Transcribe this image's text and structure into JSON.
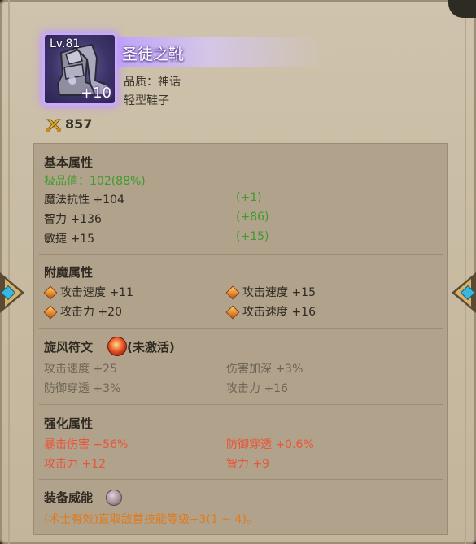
{
  "item": {
    "level": "Lv.81",
    "enhance": "+10",
    "name": "圣徒之靴",
    "quality": "品质：神话",
    "type": "轻型鞋子",
    "power": "857",
    "icon": "boots-icon",
    "frame_color": "#c9a8ff"
  },
  "basic": {
    "title": "基本属性",
    "grade": "极品值：102(88%)",
    "stats": [
      {
        "label": "魔法抗性 +104",
        "bonus": "(+1)"
      },
      {
        "label": "智力 +136",
        "bonus": "(+86)"
      },
      {
        "label": "敏捷 +15",
        "bonus": "(+15)"
      }
    ]
  },
  "enchant": {
    "title": "附魔属性",
    "stats": [
      "攻击速度 +11",
      "攻击速度 +15",
      "攻击力 +20",
      "攻击速度 +16"
    ]
  },
  "rune": {
    "title": "旋风符文",
    "status": "(未激活)",
    "stats": [
      "攻击速度 +25",
      "伤害加深 +3%",
      "防御穿透 +3%",
      "攻击力 +16"
    ]
  },
  "reinforce": {
    "title": "强化属性",
    "stats": [
      "暴击伤害 +56%",
      "防御穿透 +0.6%",
      "攻击力 +12",
      "智力 +9"
    ]
  },
  "skill": {
    "title": "装备威能",
    "desc": "(术士有效)直取敌首技能等级+3(1 ~ 4)。"
  },
  "colors": {
    "green": "#3f9a2c",
    "orange": "#e07a1e",
    "red": "#e8553a",
    "gray": "#6e6557"
  }
}
